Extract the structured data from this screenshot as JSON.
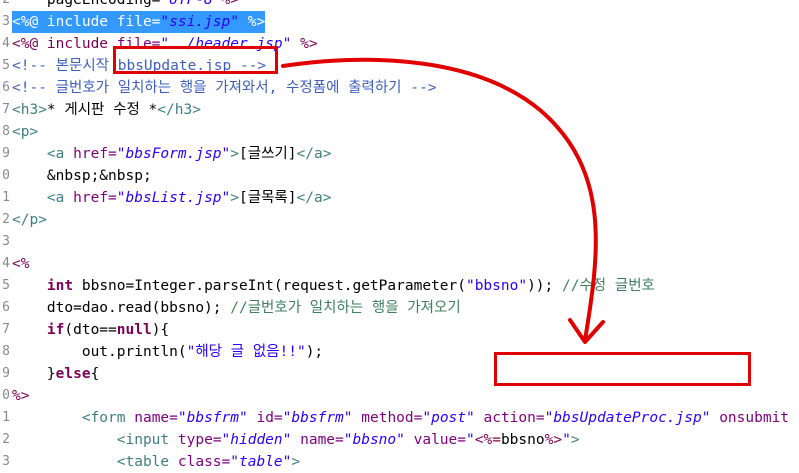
{
  "lines": [
    {
      "n": "2",
      "parts": [
        [
          "plain",
          "    pageEncoding="
        ],
        [
          "str",
          "\"UTF-8\""
        ],
        [
          "dir",
          "%>"
        ]
      ]
    },
    {
      "n": "3",
      "hl": true,
      "parts": [
        [
          "dir",
          "<%@ include file="
        ],
        [
          "str",
          "\"ssi.jsp\""
        ],
        [
          "dir",
          " %>"
        ]
      ]
    },
    {
      "n": "4",
      "parts": [
        [
          "dir",
          "<%@ include "
        ],
        [
          "att",
          "file="
        ],
        [
          "str",
          "\"../header.jsp\""
        ],
        [
          "dir",
          " %>"
        ]
      ]
    },
    {
      "n": "5",
      "parts": [
        [
          "cm",
          "<!-- 본문시작 bbsUpdate.jsp -->"
        ]
      ]
    },
    {
      "n": "6",
      "parts": [
        [
          "cm",
          "<!-- 글번호가 일치하는 행을 가져와서, 수정폼에 출력하기 -->"
        ]
      ]
    },
    {
      "n": "7",
      "parts": [
        [
          "tag",
          "<h3>"
        ],
        [
          "plain",
          "* 게시판 수정 *"
        ],
        [
          "tag",
          "</h3>"
        ]
      ]
    },
    {
      "n": "8",
      "parts": [
        [
          "tag",
          "<p>"
        ]
      ]
    },
    {
      "n": "9",
      "parts": [
        [
          "plain",
          "    "
        ],
        [
          "tag",
          "<a "
        ],
        [
          "att",
          "href="
        ],
        [
          "str",
          "\"bbsForm.jsp\""
        ],
        [
          "tag",
          ">"
        ],
        [
          "plain",
          "[글쓰기]"
        ],
        [
          "tag",
          "</a>"
        ]
      ]
    },
    {
      "n": "0",
      "parts": [
        [
          "plain",
          "    &nbsp;&nbsp;"
        ]
      ]
    },
    {
      "n": "1",
      "parts": [
        [
          "plain",
          "    "
        ],
        [
          "tag",
          "<a "
        ],
        [
          "att",
          "href="
        ],
        [
          "str",
          "\"bbsList.jsp\""
        ],
        [
          "tag",
          ">"
        ],
        [
          "plain",
          "[글목록]"
        ],
        [
          "tag",
          "</a>"
        ]
      ]
    },
    {
      "n": "2",
      "parts": [
        [
          "tag",
          "</p>"
        ]
      ]
    },
    {
      "n": "3",
      "parts": [
        [
          "plain",
          ""
        ]
      ]
    },
    {
      "n": "4",
      "parts": [
        [
          "dir",
          "<%"
        ]
      ]
    },
    {
      "n": "5",
      "parts": [
        [
          "plain",
          "    "
        ],
        [
          "kw",
          "int"
        ],
        [
          "plain",
          " bbsno=Integer.parseInt(request.getParameter("
        ],
        [
          "jstr",
          "\"bbsno\""
        ],
        [
          "plain",
          ")); "
        ],
        [
          "jcm",
          "//수정 글번호"
        ]
      ]
    },
    {
      "n": "6",
      "parts": [
        [
          "plain",
          "    dto=dao.read(bbsno); "
        ],
        [
          "jcm",
          "//글번호가 일치하는 행을 가져오기"
        ]
      ]
    },
    {
      "n": "7",
      "parts": [
        [
          "plain",
          "    "
        ],
        [
          "kw",
          "if"
        ],
        [
          "plain",
          "(dto=="
        ],
        [
          "kw",
          "null"
        ],
        [
          "plain",
          "){"
        ]
      ]
    },
    {
      "n": "8",
      "parts": [
        [
          "plain",
          "        out.println("
        ],
        [
          "jstr",
          "\"해당 글 없음!!\""
        ],
        [
          "plain",
          ");"
        ]
      ]
    },
    {
      "n": "9",
      "parts": [
        [
          "plain",
          "    }"
        ],
        [
          "kw",
          "else"
        ],
        [
          "plain",
          "{"
        ]
      ]
    },
    {
      "n": "0",
      "parts": [
        [
          "dir",
          "%>"
        ]
      ]
    },
    {
      "n": "1",
      "parts": [
        [
          "plain",
          "        "
        ],
        [
          "tag",
          "<form "
        ],
        [
          "att",
          "name="
        ],
        [
          "str",
          "\"bbsfrm\""
        ],
        [
          "plain",
          " "
        ],
        [
          "att",
          "id="
        ],
        [
          "str",
          "\"bbsfrm\""
        ],
        [
          "plain",
          " "
        ],
        [
          "att",
          "method="
        ],
        [
          "str",
          "\"post\""
        ],
        [
          "plain",
          " "
        ],
        [
          "att",
          "action="
        ],
        [
          "str",
          "\"bbsUpdateProc.jsp\""
        ],
        [
          "plain",
          " "
        ],
        [
          "att",
          "onsubmit"
        ]
      ]
    },
    {
      "n": "2",
      "parts": [
        [
          "plain",
          "            "
        ],
        [
          "tag",
          "<input "
        ],
        [
          "att",
          "type="
        ],
        [
          "str",
          "\"hidden\""
        ],
        [
          "plain",
          " "
        ],
        [
          "att",
          "name="
        ],
        [
          "str",
          "\"bbsno\""
        ],
        [
          "plain",
          " "
        ],
        [
          "att",
          "value="
        ],
        [
          "str",
          "\""
        ],
        [
          "dir",
          "<%="
        ],
        [
          "plain",
          "bbsno"
        ],
        [
          "dir",
          "%>"
        ],
        [
          "str",
          "\""
        ],
        [
          "tag",
          ">"
        ]
      ]
    },
    {
      "n": "3",
      "parts": [
        [
          "plain",
          "            "
        ],
        [
          "tag",
          "<table "
        ],
        [
          "att",
          "class="
        ],
        [
          "str",
          "\"table\""
        ],
        [
          "tag",
          ">"
        ]
      ]
    }
  ],
  "colors": {
    "annotation": "#e00000",
    "selection": "#3399ff"
  }
}
